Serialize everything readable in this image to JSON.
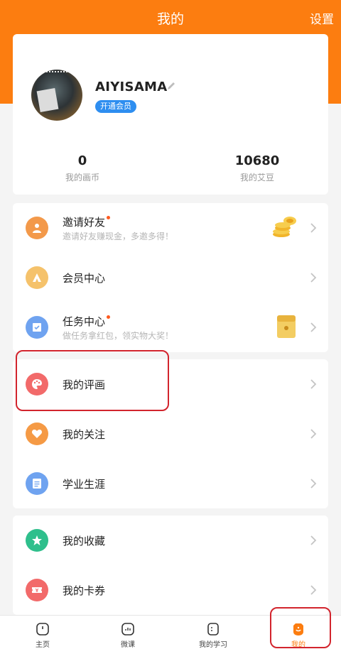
{
  "header": {
    "title": "我的",
    "settings_label": "设置"
  },
  "profile": {
    "username": "AIYISAMA",
    "vip_label": "开通会员",
    "stats": [
      {
        "value": "0",
        "label": "我的画币"
      },
      {
        "value": "10680",
        "label": "我的艾豆"
      }
    ]
  },
  "menu_group1": [
    {
      "label": "邀请好友",
      "sub": "邀请好友赚现金，多邀多得！",
      "badge": true,
      "icon": "invite-user-icon",
      "color": "#f3994a"
    },
    {
      "label": "会员中心",
      "icon": "vip-crown-icon",
      "color": "#f5c26b"
    },
    {
      "label": "任务中心",
      "sub": "做任务拿红包，领实物大奖！",
      "badge": true,
      "icon": "task-check-icon",
      "color": "#6fa3f0"
    }
  ],
  "menu_group2": [
    {
      "label": "我的评画",
      "icon": "palette-icon",
      "color": "#f26a6a"
    },
    {
      "label": "我的关注",
      "icon": "heart-icon",
      "color": "#f59a45"
    },
    {
      "label": "学业生涯",
      "icon": "document-icon",
      "color": "#6fa3f0"
    }
  ],
  "menu_group3": [
    {
      "label": "我的收藏",
      "icon": "star-icon",
      "color": "#2fbf8c"
    },
    {
      "label": "我的卡券",
      "icon": "ticket-icon",
      "color": "#f26a6a"
    }
  ],
  "tabbar": [
    {
      "label": "主页",
      "icon": "home-icon"
    },
    {
      "label": "微课",
      "icon": "video-course-icon"
    },
    {
      "label": "我的学习",
      "icon": "notebook-icon"
    },
    {
      "label": "我的",
      "icon": "profile-face-icon",
      "active": true
    }
  ],
  "colors": {
    "brand": "#fc7d10",
    "highlight": "#d2242d",
    "vip_badge": "#2e8ef0"
  }
}
